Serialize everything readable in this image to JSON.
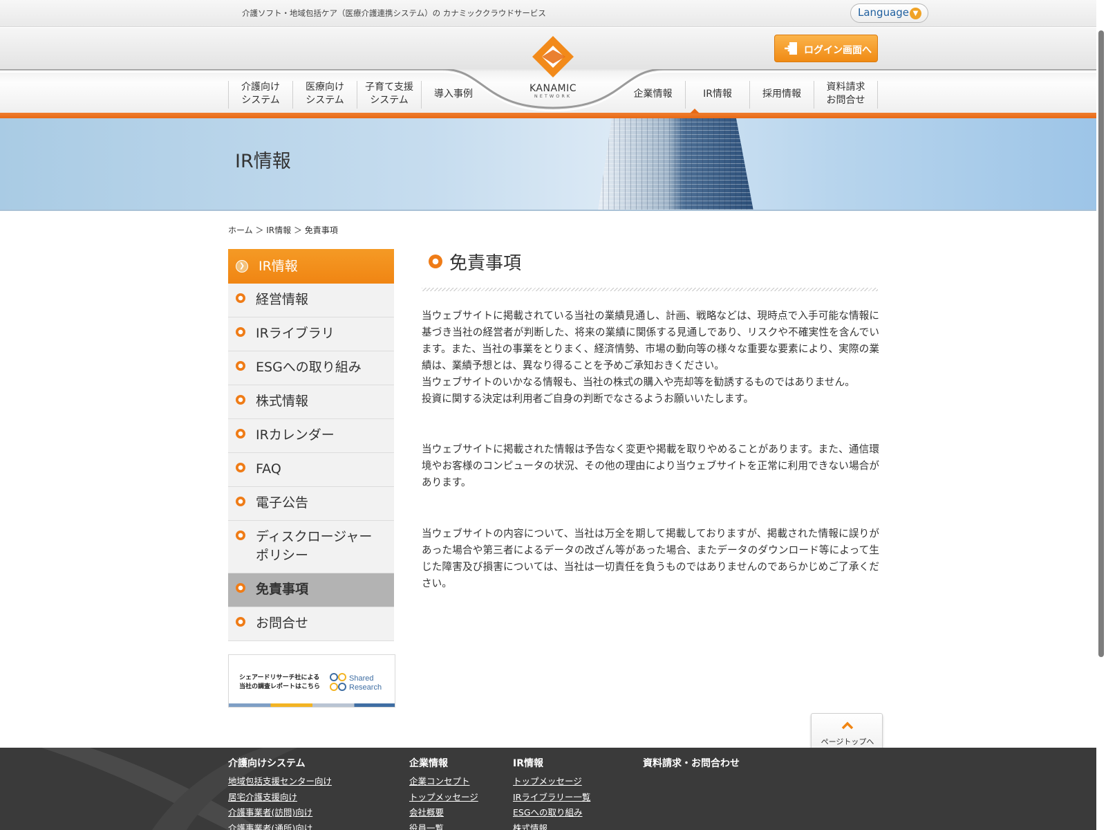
{
  "topbar": {
    "tagline": "介護ソフト・地域包括ケア（医療介護連携システム）の カナミッククラウドサービス",
    "language_label": "Language"
  },
  "header": {
    "login_label": "ログイン画面へ",
    "logo_word": "KANAMIC",
    "logo_sub": "NETWORK",
    "nav_left": [
      {
        "label": "介護向け\nシステム"
      },
      {
        "label": "医療向け\nシステム"
      },
      {
        "label": "子育て支援\nシステム"
      },
      {
        "label": "導入事例"
      }
    ],
    "nav_right": [
      {
        "label": "企業情報"
      },
      {
        "label": "IR情報"
      },
      {
        "label": "採用情報"
      },
      {
        "label": "資料請求\nお問合せ"
      }
    ]
  },
  "hero": {
    "title": "IR情報"
  },
  "breadcrumb": "ホーム ＞ IR情報 ＞ 免責事項",
  "sidebar": {
    "heading": "IR情報",
    "items": [
      {
        "label": "経営情報"
      },
      {
        "label": "IRライブラリ"
      },
      {
        "label": "ESGへの取り組み"
      },
      {
        "label": "株式情報"
      },
      {
        "label": "IRカレンダー"
      },
      {
        "label": "FAQ"
      },
      {
        "label": "電子公告"
      },
      {
        "label": "ディスクロージャー\nポリシー"
      },
      {
        "label": "免責事項"
      },
      {
        "label": "お問合せ"
      }
    ],
    "active_index": 8,
    "banner_text": "シェアードリサーチ社による\n当社の調査レポートはこちら",
    "banner_brand_1": "Shared",
    "banner_brand_2": "Research"
  },
  "content": {
    "title": "免責事項",
    "paragraphs": [
      "当ウェブサイトに掲載されている当社の業績見通し、計画、戦略などは、現時点で入手可能な情報に基づき当社の経営者が判断した、将来の業績に関係する見通しであり、リスクや不確実性を含んでいます。また、当社の事業をとりまく、経済情勢、市場の動向等の様々な重要な要素により、実際の業績は、業績予想とは、異なり得ることを予めご承知おきください。\n当ウェブサイトのいかなる情報も、当社の株式の購入や売却等を勧誘するものではありません。\n投資に関する決定は利用者ご自身の判断でなさるようお願いいたします。",
      "当ウェブサイトに掲載された情報は予告なく変更や掲載を取りやめることがあります。また、通信環境やお客様のコンピュータの状況、その他の理由により当ウェブサイトを正常に利用できない場合があります。",
      "当ウェブサイトの内容について、当社は万全を期して掲載しておりますが、掲載された情報に誤りがあった場合や第三者によるデータの改ざん等があった場合、またデータのダウンロード等によって生じた障害及び損害については、当社は一切責任を負うものではありませんのであらかじめご了承ください。"
    ]
  },
  "to_top_label": "ページトップへ",
  "footer": {
    "columns": [
      {
        "heading": "介護向けシステム",
        "links": [
          "地域包括支援センター向け",
          "居宅介護支援向け",
          "介護事業者(訪問)向け",
          "介護事業者(通所)向け"
        ]
      },
      {
        "heading": "企業情報",
        "links": [
          "企業コンセプト",
          "トップメッセージ",
          "会社概要",
          "役員一覧"
        ]
      },
      {
        "heading": "IR情報",
        "links": [
          "トップメッセージ",
          "IRライブラリー一覧",
          "ESGへの取り組み",
          "株式情報"
        ]
      },
      {
        "heading": "資料請求・お問合わせ",
        "links": []
      }
    ]
  },
  "colors": {
    "accent_orange": "#f08513",
    "nav_orange_line": "#e96a16",
    "link_blue": "#1f5f9e",
    "footer_bg": "#3a3a3a"
  }
}
